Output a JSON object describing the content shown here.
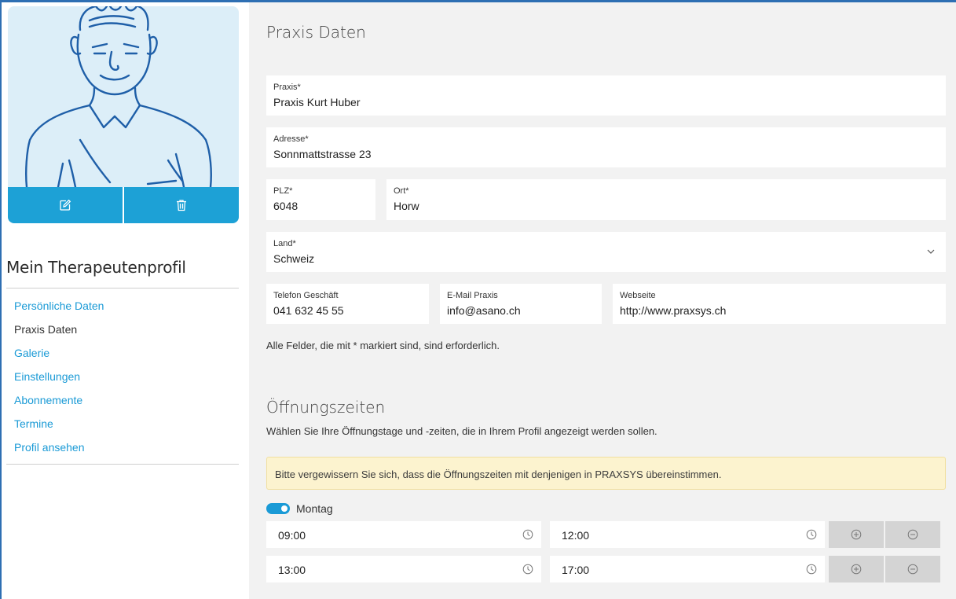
{
  "sidebar": {
    "profile_title": "Mein Therapeutenprofil",
    "nav": [
      {
        "label": "Persönliche Daten",
        "active": false
      },
      {
        "label": "Praxis Daten",
        "active": true
      },
      {
        "label": "Galerie",
        "active": false
      },
      {
        "label": "Einstellungen",
        "active": false
      },
      {
        "label": "Abonnemente",
        "active": false
      },
      {
        "label": "Termine",
        "active": false
      },
      {
        "label": "Profil ansehen",
        "active": false
      }
    ],
    "avatar_actions": [
      "edit-icon",
      "trash-icon"
    ]
  },
  "praxis": {
    "title": "Praxis Daten",
    "praxis": {
      "label": "Praxis*",
      "value": "Praxis Kurt Huber"
    },
    "adresse": {
      "label": "Adresse*",
      "value": "Sonnmattstrasse 23"
    },
    "plz": {
      "label": "PLZ*",
      "value": "6048"
    },
    "ort": {
      "label": "Ort*",
      "value": "Horw"
    },
    "land": {
      "label": "Land*",
      "value": "Schweiz"
    },
    "telefon": {
      "label": "Telefon Geschäft",
      "value": "041 632 45 55"
    },
    "email": {
      "label": "E-Mail Praxis",
      "value": "info@asano.ch"
    },
    "webseite": {
      "label": "Webseite",
      "value": "http://www.praxsys.ch"
    },
    "required_note": "Alle Felder, die mit * markiert sind, sind erforderlich."
  },
  "hours": {
    "title": "Öffnungszeiten",
    "hint": "Wählen Sie Ihre Öffnungstage und -zeiten, die in Ihrem Profil angezeigt werden sollen.",
    "warning": "Bitte vergewissern Sie sich, dass die Öffnungszeiten mit denjenigen in PRAXSYS übereinstimmen.",
    "day": "Montag",
    "day_enabled": true,
    "slots": [
      {
        "from": "09:00",
        "to": "12:00"
      },
      {
        "from": "13:00",
        "to": "17:00"
      }
    ]
  },
  "colors": {
    "accent": "#1da1d6",
    "link": "#1a9ad6",
    "warning_bg": "#fcf3cf",
    "main_bg": "#f2f2f2",
    "avatar_bg": "#dceef8"
  }
}
